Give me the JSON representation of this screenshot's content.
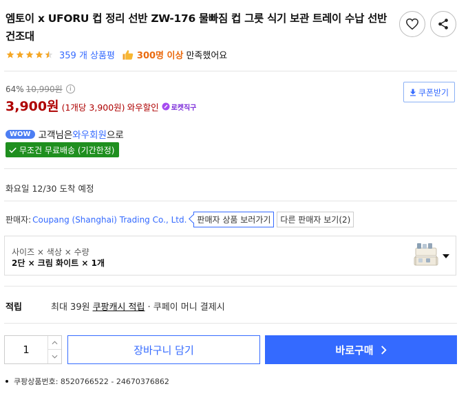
{
  "product": {
    "title": "엠토이 x UFORU 컵 정리 선반 ZW-176 물빠짐 컵 그릇 식기 보관 트레이 수납 선반 건조대",
    "rating": 4.5,
    "review_count": "359 개 상품평",
    "satisfied_count": "300명 이상",
    "satisfied_suffix": "만족했어요"
  },
  "pricing": {
    "discount_rate": "64%",
    "original_price": "10,990원",
    "price": "3,900원",
    "unit_price": "(1개당 3,900원)",
    "wow_discount": "와우할인",
    "rocket_label": "로켓직구",
    "coupon_button": "쿠폰받기"
  },
  "membership": {
    "wow_badge": "WOW",
    "text_prefix": "고객님은 ",
    "member_type": "와우회원",
    "text_suffix": "으로",
    "free_shipping": "무조건 무료배송 (기간한정)"
  },
  "delivery": {
    "text": "화요일 12/30 도착 예정"
  },
  "seller": {
    "label": "판매자:",
    "name": "Coupang (Shanghai) Trading Co., Ltd.",
    "view_products_button": "판매자 상품 보러가기",
    "other_sellers_button": "다른 판매자 보기(2)"
  },
  "options": {
    "labels": "사이즈 × 색상 × 수량",
    "selected": "2단 × 크림 화이트 × 1개"
  },
  "reward": {
    "title": "적립",
    "prefix": "최대 39원",
    "cash_link": "쿠팡캐시 적립",
    "suffix": "· 쿠페이 머니 결제시"
  },
  "purchase": {
    "quantity": "1",
    "cart_button": "장바구니 담기",
    "buy_button": "바로구매"
  },
  "meta": {
    "product_number": "쿠팡상품번호: 8520766522 - 24670376862"
  },
  "colors": {
    "accent_blue": "#346aff",
    "price_red": "#ae0000",
    "free_ship_green": "#1f8f1f",
    "star_orange": "#f5a623"
  },
  "icons": {
    "wishlist": "heart-icon",
    "share": "share-icon",
    "thumbs_up": "thumbs-up-icon",
    "coupon": "download-icon",
    "free_shipping": "check-icon",
    "buy": "chevron-right-icon"
  }
}
